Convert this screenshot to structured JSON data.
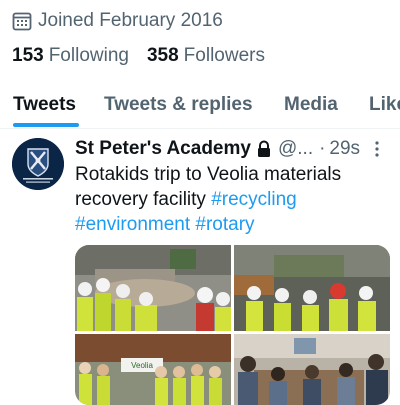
{
  "profile": {
    "joined_text": "Joined February 2016",
    "following_count": "153",
    "following_label": "Following",
    "followers_count": "358",
    "followers_label": "Followers"
  },
  "tabs": [
    {
      "label": "Tweets"
    },
    {
      "label": "Tweets & replies"
    },
    {
      "label": "Media"
    },
    {
      "label": "Likes"
    }
  ],
  "tweet": {
    "author": "St Peter's Academy",
    "handle": "@...",
    "separator": "·",
    "time": "29s",
    "text_plain": "Rotakids trip to Veolia materials recovery facility ",
    "hashtags": [
      "#recycling",
      "#environment",
      "#rotary"
    ],
    "image_sign_text": "Veolia"
  },
  "colors": {
    "accent": "#1d9bf0",
    "secondary_text": "#536471",
    "primary_text": "#0f1419"
  }
}
